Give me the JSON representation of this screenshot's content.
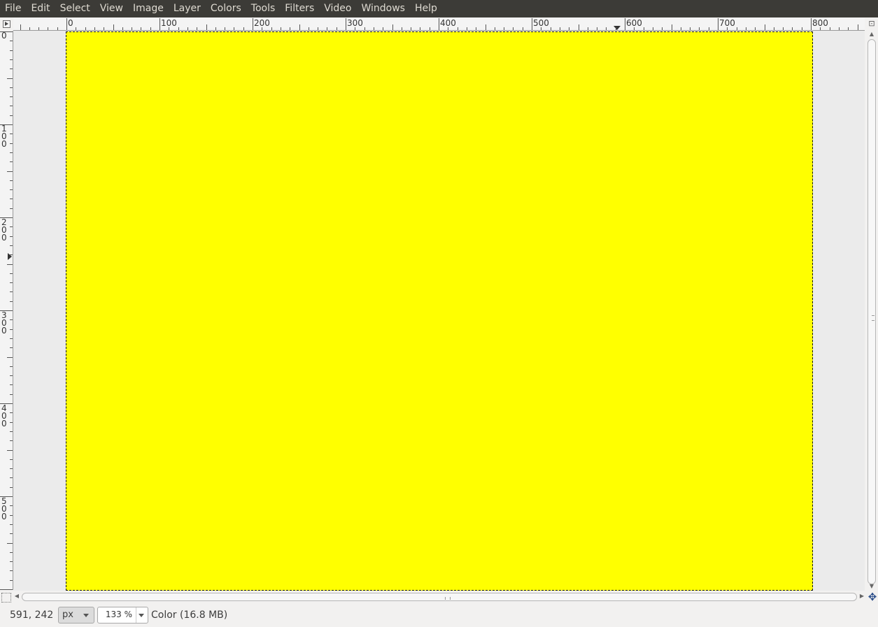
{
  "menubar": {
    "items": [
      "File",
      "Edit",
      "Select",
      "View",
      "Image",
      "Layer",
      "Colors",
      "Tools",
      "Filters",
      "Video",
      "Windows",
      "Help"
    ]
  },
  "rulers": {
    "horizontal_labels": [
      "0",
      "100",
      "200",
      "300",
      "400",
      "500",
      "600",
      "700",
      "800"
    ],
    "vertical_labels": [
      "0",
      "100",
      "200",
      "300",
      "400",
      "500"
    ]
  },
  "canvas": {
    "fill_color": "#ffff00"
  },
  "statusbar": {
    "pointer_coords": "591, 242",
    "unit": "px",
    "zoom": "133 %",
    "status_text": "Color (16.8 MB)"
  },
  "icons": {
    "corner": "quick-menu-icon",
    "navigate": "navigate-icon",
    "zoom_toggle": "zoom-toggle-icon",
    "quick_mask": "quick-mask-icon"
  }
}
